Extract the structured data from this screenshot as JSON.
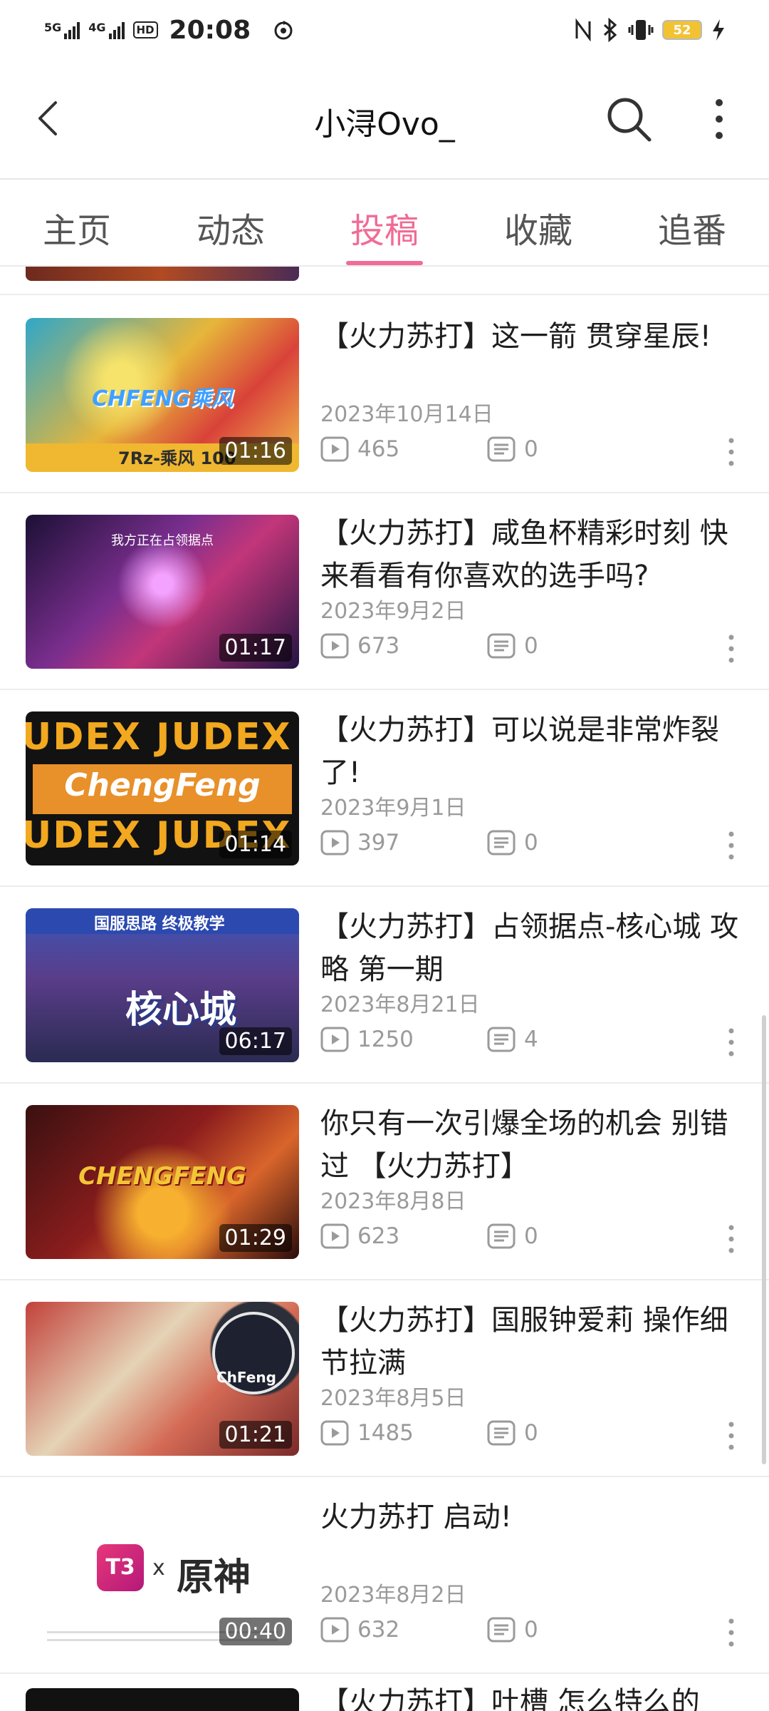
{
  "status_bar": {
    "signal1_label": "5G",
    "signal2_label": "4G",
    "hd_label": "HD",
    "time": "20:08",
    "battery_level": "52",
    "icons": [
      "nfc-icon",
      "bluetooth-icon",
      "vibrate-icon",
      "battery-icon",
      "charging-icon"
    ]
  },
  "header": {
    "title": "小浔Ovo_",
    "back_icon": "chevron-left-icon",
    "search_icon": "search-icon",
    "more_icon": "more-vertical-icon"
  },
  "tabs": [
    {
      "label": "主页",
      "active": false
    },
    {
      "label": "动态",
      "active": false
    },
    {
      "label": "投稿",
      "active": true
    },
    {
      "label": "收藏",
      "active": false
    },
    {
      "label": "追番",
      "active": false
    }
  ],
  "accent_color": "#f06c96",
  "videos": [
    {
      "title": "【火力苏打】这一箭 贯穿星辰!",
      "date": "2023年10月14日",
      "views": "465",
      "comments": "0",
      "duration": "01:16",
      "thumb_text": "CHFENG乘风",
      "thumb_sub": "7Rz-乘风 100"
    },
    {
      "title": "【火力苏打】咸鱼杯精彩时刻 快来看看有你喜欢的选手吗?",
      "date": "2023年9月2日",
      "views": "673",
      "comments": "0",
      "duration": "01:17",
      "thumb_text": "我方正在占领据点"
    },
    {
      "title": "【火力苏打】可以说是非常炸裂了!",
      "date": "2023年9月1日",
      "views": "397",
      "comments": "0",
      "duration": "01:14",
      "thumb_text": "ChengFeng",
      "thumb_band": "UDEX JUDEX JUDI"
    },
    {
      "title": "【火力苏打】占领据点-核心城 攻略 第一期",
      "date": "2023年8月21日",
      "views": "1250",
      "comments": "4",
      "duration": "06:17",
      "thumb_text": "核心城",
      "thumb_sub": "国服思路 终极教学"
    },
    {
      "title": "你只有一次引爆全场的机会 别错过 【火力苏打】",
      "date": "2023年8月8日",
      "views": "623",
      "comments": "0",
      "duration": "01:29",
      "thumb_text": "CHENGFENG"
    },
    {
      "title": "【火力苏打】国服钟爱莉 操作细节拉满",
      "date": "2023年8月5日",
      "views": "1485",
      "comments": "0",
      "duration": "01:21",
      "thumb_text": "ChFeng"
    },
    {
      "title": "火力苏打 启动!",
      "date": "2023年8月2日",
      "views": "632",
      "comments": "0",
      "duration": "00:40",
      "thumb_text": "T3",
      "thumb_x": "x",
      "thumb_sub": "原神"
    }
  ],
  "next_video_peek": {
    "title": "【火力苏打】吐槽 怎么特么的"
  },
  "icons": {
    "views": "play-icon",
    "comments": "danmaku-icon",
    "item_more": "more-vertical-icon"
  }
}
